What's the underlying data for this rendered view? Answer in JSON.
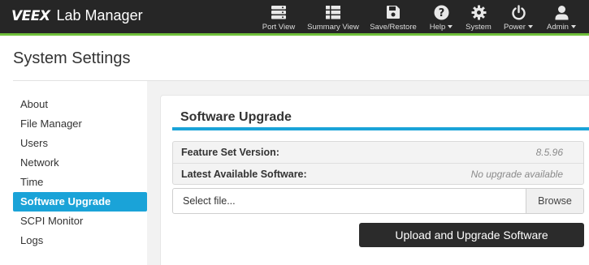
{
  "header": {
    "logo": "VEEX",
    "app_title": "Lab Manager",
    "accent_color": "#6fbf3a",
    "nav": [
      {
        "label": "Port View",
        "icon": "server-icon"
      },
      {
        "label": "Summary View",
        "icon": "grid-icon"
      },
      {
        "label": "Save/Restore",
        "icon": "floppy-disk-icon"
      },
      {
        "label": "Help",
        "icon": "help-circle-icon",
        "dropdown": true
      },
      {
        "label": "System",
        "icon": "gear-icon"
      },
      {
        "label": "Power",
        "icon": "power-icon",
        "dropdown": true
      },
      {
        "label": "Admin",
        "icon": "user-icon",
        "dropdown": true
      }
    ]
  },
  "page": {
    "title": "System Settings"
  },
  "sidebar": {
    "active_color": "#1aa3d8",
    "items": [
      {
        "label": "About"
      },
      {
        "label": "File Manager"
      },
      {
        "label": "Users"
      },
      {
        "label": "Network"
      },
      {
        "label": "Time"
      },
      {
        "label": "Software Upgrade",
        "active": true
      },
      {
        "label": "SCPI Monitor"
      },
      {
        "label": "Logs"
      }
    ]
  },
  "upgrade": {
    "title": "Software Upgrade",
    "rows": [
      {
        "label": "Feature Set Version:",
        "value": "8.5.96"
      },
      {
        "label": "Latest Available Software:",
        "value": "No upgrade available"
      }
    ],
    "file_placeholder": "Select file...",
    "browse_label": "Browse",
    "upload_label": "Upload and Upgrade Software"
  }
}
